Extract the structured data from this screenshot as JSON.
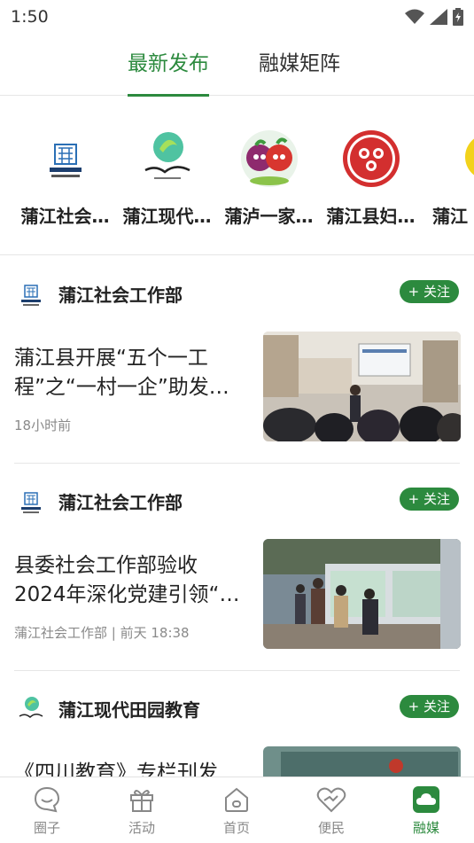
{
  "status": {
    "time": "1:50"
  },
  "tabs": [
    {
      "label": "最新发布",
      "active": true
    },
    {
      "label": "融媒矩阵",
      "active": false
    }
  ],
  "accounts": [
    {
      "name": "蒲江社会…"
    },
    {
      "name": "蒲江现代…"
    },
    {
      "name": "蒲泸一家…"
    },
    {
      "name": "蒲江县妇…"
    },
    {
      "name": "蒲江"
    }
  ],
  "feed": [
    {
      "source": "蒲江社会工作部",
      "follow": "关注",
      "title": "蒲江县开展“五个一工程”之“一村一企”助发…",
      "meta": "18小时前"
    },
    {
      "source": "蒲江社会工作部",
      "follow": "关注",
      "title": "县委社会工作部验收2024年深化党建引领“…",
      "meta": "蒲江社会工作部 | 前天 18:38"
    },
    {
      "source": "蒲江现代田园教育",
      "follow": "关注",
      "title": "《四川教育》专栏刊发",
      "meta": ""
    }
  ],
  "bottom_nav": [
    {
      "label": "圈子",
      "icon": "chat-bubble-icon",
      "active": false
    },
    {
      "label": "活动",
      "icon": "gift-icon",
      "active": false
    },
    {
      "label": "首页",
      "icon": "home-icon",
      "active": false
    },
    {
      "label": "便民",
      "icon": "heart-hands-icon",
      "active": false
    },
    {
      "label": "融媒",
      "icon": "cloud-icon",
      "active": true
    }
  ],
  "colors": {
    "accent": "#2c8a3e",
    "divider": "#e6e6e6",
    "muted": "#888888"
  }
}
